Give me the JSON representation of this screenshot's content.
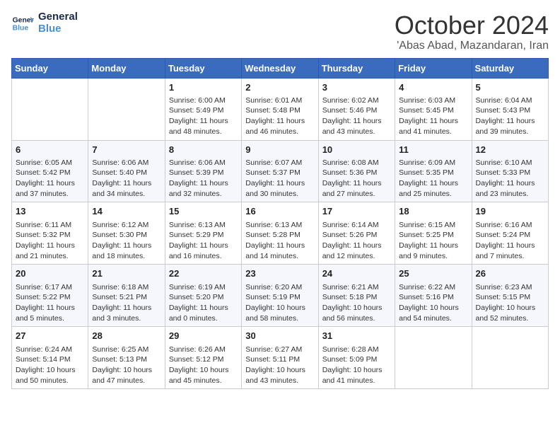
{
  "header": {
    "logo_line1": "General",
    "logo_line2": "Blue",
    "month": "October 2024",
    "location": "'Abas Abad, Mazandaran, Iran"
  },
  "weekdays": [
    "Sunday",
    "Monday",
    "Tuesday",
    "Wednesday",
    "Thursday",
    "Friday",
    "Saturday"
  ],
  "weeks": [
    [
      {
        "day": "",
        "info": ""
      },
      {
        "day": "",
        "info": ""
      },
      {
        "day": "1",
        "info": "Sunrise: 6:00 AM\nSunset: 5:49 PM\nDaylight: 11 hours and 48 minutes."
      },
      {
        "day": "2",
        "info": "Sunrise: 6:01 AM\nSunset: 5:48 PM\nDaylight: 11 hours and 46 minutes."
      },
      {
        "day": "3",
        "info": "Sunrise: 6:02 AM\nSunset: 5:46 PM\nDaylight: 11 hours and 43 minutes."
      },
      {
        "day": "4",
        "info": "Sunrise: 6:03 AM\nSunset: 5:45 PM\nDaylight: 11 hours and 41 minutes."
      },
      {
        "day": "5",
        "info": "Sunrise: 6:04 AM\nSunset: 5:43 PM\nDaylight: 11 hours and 39 minutes."
      }
    ],
    [
      {
        "day": "6",
        "info": "Sunrise: 6:05 AM\nSunset: 5:42 PM\nDaylight: 11 hours and 37 minutes."
      },
      {
        "day": "7",
        "info": "Sunrise: 6:06 AM\nSunset: 5:40 PM\nDaylight: 11 hours and 34 minutes."
      },
      {
        "day": "8",
        "info": "Sunrise: 6:06 AM\nSunset: 5:39 PM\nDaylight: 11 hours and 32 minutes."
      },
      {
        "day": "9",
        "info": "Sunrise: 6:07 AM\nSunset: 5:37 PM\nDaylight: 11 hours and 30 minutes."
      },
      {
        "day": "10",
        "info": "Sunrise: 6:08 AM\nSunset: 5:36 PM\nDaylight: 11 hours and 27 minutes."
      },
      {
        "day": "11",
        "info": "Sunrise: 6:09 AM\nSunset: 5:35 PM\nDaylight: 11 hours and 25 minutes."
      },
      {
        "day": "12",
        "info": "Sunrise: 6:10 AM\nSunset: 5:33 PM\nDaylight: 11 hours and 23 minutes."
      }
    ],
    [
      {
        "day": "13",
        "info": "Sunrise: 6:11 AM\nSunset: 5:32 PM\nDaylight: 11 hours and 21 minutes."
      },
      {
        "day": "14",
        "info": "Sunrise: 6:12 AM\nSunset: 5:30 PM\nDaylight: 11 hours and 18 minutes."
      },
      {
        "day": "15",
        "info": "Sunrise: 6:13 AM\nSunset: 5:29 PM\nDaylight: 11 hours and 16 minutes."
      },
      {
        "day": "16",
        "info": "Sunrise: 6:13 AM\nSunset: 5:28 PM\nDaylight: 11 hours and 14 minutes."
      },
      {
        "day": "17",
        "info": "Sunrise: 6:14 AM\nSunset: 5:26 PM\nDaylight: 11 hours and 12 minutes."
      },
      {
        "day": "18",
        "info": "Sunrise: 6:15 AM\nSunset: 5:25 PM\nDaylight: 11 hours and 9 minutes."
      },
      {
        "day": "19",
        "info": "Sunrise: 6:16 AM\nSunset: 5:24 PM\nDaylight: 11 hours and 7 minutes."
      }
    ],
    [
      {
        "day": "20",
        "info": "Sunrise: 6:17 AM\nSunset: 5:22 PM\nDaylight: 11 hours and 5 minutes."
      },
      {
        "day": "21",
        "info": "Sunrise: 6:18 AM\nSunset: 5:21 PM\nDaylight: 11 hours and 3 minutes."
      },
      {
        "day": "22",
        "info": "Sunrise: 6:19 AM\nSunset: 5:20 PM\nDaylight: 11 hours and 0 minutes."
      },
      {
        "day": "23",
        "info": "Sunrise: 6:20 AM\nSunset: 5:19 PM\nDaylight: 10 hours and 58 minutes."
      },
      {
        "day": "24",
        "info": "Sunrise: 6:21 AM\nSunset: 5:18 PM\nDaylight: 10 hours and 56 minutes."
      },
      {
        "day": "25",
        "info": "Sunrise: 6:22 AM\nSunset: 5:16 PM\nDaylight: 10 hours and 54 minutes."
      },
      {
        "day": "26",
        "info": "Sunrise: 6:23 AM\nSunset: 5:15 PM\nDaylight: 10 hours and 52 minutes."
      }
    ],
    [
      {
        "day": "27",
        "info": "Sunrise: 6:24 AM\nSunset: 5:14 PM\nDaylight: 10 hours and 50 minutes."
      },
      {
        "day": "28",
        "info": "Sunrise: 6:25 AM\nSunset: 5:13 PM\nDaylight: 10 hours and 47 minutes."
      },
      {
        "day": "29",
        "info": "Sunrise: 6:26 AM\nSunset: 5:12 PM\nDaylight: 10 hours and 45 minutes."
      },
      {
        "day": "30",
        "info": "Sunrise: 6:27 AM\nSunset: 5:11 PM\nDaylight: 10 hours and 43 minutes."
      },
      {
        "day": "31",
        "info": "Sunrise: 6:28 AM\nSunset: 5:09 PM\nDaylight: 10 hours and 41 minutes."
      },
      {
        "day": "",
        "info": ""
      },
      {
        "day": "",
        "info": ""
      }
    ]
  ]
}
